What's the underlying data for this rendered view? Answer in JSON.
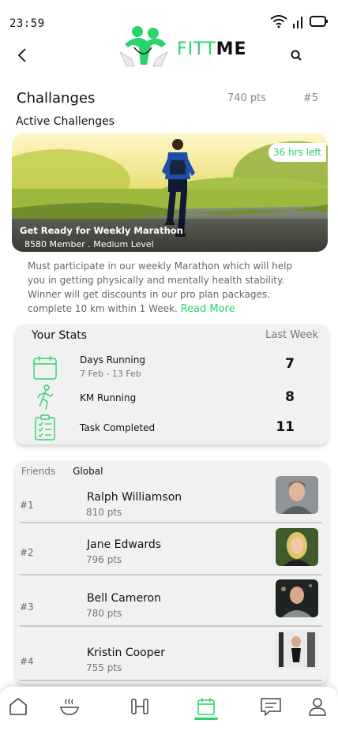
{
  "status_bar": {
    "time": "23:59"
  },
  "header": {
    "logo_fit": "FITT",
    "logo_me": "ME"
  },
  "challenges": {
    "title": "Challanges",
    "points": "740 pts",
    "rank": "#5",
    "subtitle": "Active Challenges"
  },
  "hero": {
    "badge": "36 hrs left",
    "title": "Get Ready for Weekly Marathon",
    "meta": "8580 Member . Medium Level",
    "description": "Must participate in our weekly Marathon which will help you in getting physically and mentally health stability. Winner will get discounts in our pro plan packages. complete 10 km within 1 Week.",
    "read_more": "Read More"
  },
  "stats": {
    "title": "Your Stats",
    "period": "Last Week",
    "rows": [
      {
        "label": "Days Running",
        "sub": "7 Feb - 13 Feb",
        "value": "7",
        "icon": "calendar-icon"
      },
      {
        "label": "KM Running",
        "sub": "",
        "value": "8",
        "icon": "runner-icon"
      },
      {
        "label": "Task Completed",
        "sub": "",
        "value": "11",
        "icon": "checklist-icon"
      }
    ]
  },
  "leaderboard": {
    "tabs": [
      "Friends",
      "Global"
    ],
    "active_tab": "Global",
    "rows": [
      {
        "rank": "#1",
        "name": "Ralph Williamson",
        "pts": "810 pts"
      },
      {
        "rank": "#2",
        "name": "Jane Edwards",
        "pts": "796 pts"
      },
      {
        "rank": "#3",
        "name": "Bell Cameron",
        "pts": "780 pts"
      },
      {
        "rank": "#4",
        "name": "Kristin Cooper",
        "pts": "755 pts"
      }
    ]
  },
  "nav": {
    "items": [
      "home-icon",
      "food-bowl-icon",
      "dumbbell-icon",
      "calendar-icon",
      "chat-icon",
      "profile-icon"
    ],
    "active": "calendar-icon"
  },
  "colors": {
    "accent": "#2bd36c"
  }
}
